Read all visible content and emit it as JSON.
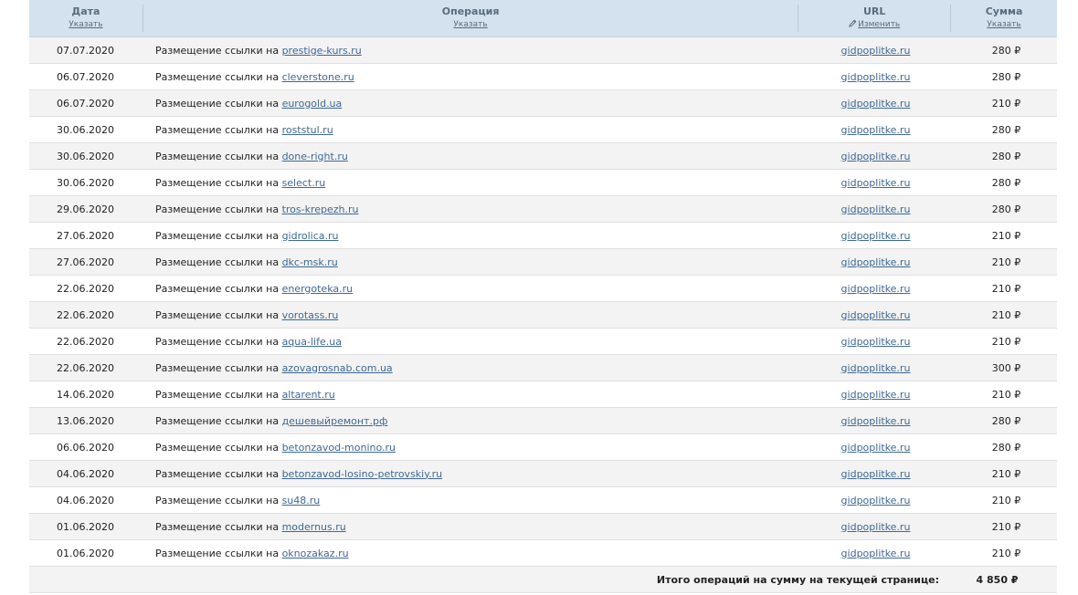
{
  "columns": {
    "date": {
      "title": "Дата",
      "action": "Указать"
    },
    "operation": {
      "title": "Операция",
      "action": "Указать"
    },
    "url": {
      "title": "URL",
      "action": "Изменить"
    },
    "sum": {
      "title": "Сумма",
      "action": "Указать"
    }
  },
  "operation_prefix": "Размещение ссылки на",
  "rows": [
    {
      "date": "07.07.2020",
      "site": "prestige-kurs.ru",
      "url": "gidpoplitke.ru",
      "sum": "280 ₽"
    },
    {
      "date": "06.07.2020",
      "site": "cleverstone.ru",
      "url": "gidpoplitke.ru",
      "sum": "280 ₽"
    },
    {
      "date": "06.07.2020",
      "site": "eurogold.ua",
      "url": "gidpoplitke.ru",
      "sum": "210 ₽"
    },
    {
      "date": "30.06.2020",
      "site": "roststul.ru",
      "url": "gidpoplitke.ru",
      "sum": "280 ₽"
    },
    {
      "date": "30.06.2020",
      "site": "done-right.ru",
      "url": "gidpoplitke.ru",
      "sum": "280 ₽"
    },
    {
      "date": "30.06.2020",
      "site": "select.ru",
      "url": "gidpoplitke.ru",
      "sum": "280 ₽"
    },
    {
      "date": "29.06.2020",
      "site": "tros-krepezh.ru",
      "url": "gidpoplitke.ru",
      "sum": "280 ₽"
    },
    {
      "date": "27.06.2020",
      "site": "gidrolica.ru",
      "url": "gidpoplitke.ru",
      "sum": "210 ₽"
    },
    {
      "date": "27.06.2020",
      "site": "dkc-msk.ru",
      "url": "gidpoplitke.ru",
      "sum": "210 ₽"
    },
    {
      "date": "22.06.2020",
      "site": "energoteka.ru",
      "url": "gidpoplitke.ru",
      "sum": "210 ₽"
    },
    {
      "date": "22.06.2020",
      "site": "vorotass.ru",
      "url": "gidpoplitke.ru",
      "sum": "210 ₽"
    },
    {
      "date": "22.06.2020",
      "site": "aqua-life.ua",
      "url": "gidpoplitke.ru",
      "sum": "210 ₽"
    },
    {
      "date": "22.06.2020",
      "site": "azovagrosnab.com.ua",
      "url": "gidpoplitke.ru",
      "sum": "300 ₽"
    },
    {
      "date": "14.06.2020",
      "site": "altarent.ru",
      "url": "gidpoplitke.ru",
      "sum": "210 ₽"
    },
    {
      "date": "13.06.2020",
      "site": "дешевыйремонт.рф",
      "url": "gidpoplitke.ru",
      "sum": "280 ₽"
    },
    {
      "date": "06.06.2020",
      "site": "betonzavod-monino.ru",
      "url": "gidpoplitke.ru",
      "sum": "280 ₽"
    },
    {
      "date": "04.06.2020",
      "site": "betonzavod-losino-petrovskiy.ru",
      "url": "gidpoplitke.ru",
      "sum": "210 ₽"
    },
    {
      "date": "04.06.2020",
      "site": "su48.ru",
      "url": "gidpoplitke.ru",
      "sum": "210 ₽"
    },
    {
      "date": "01.06.2020",
      "site": "modernus.ru",
      "url": "gidpoplitke.ru",
      "sum": "210 ₽"
    },
    {
      "date": "01.06.2020",
      "site": "oknozakaz.ru",
      "url": "gidpoplitke.ru",
      "sum": "210 ₽"
    }
  ],
  "total": {
    "label": "Итого операций на сумму на текущей странице:",
    "value": "4 850 ₽"
  },
  "colors": {
    "header_bg": "#d3e2ee",
    "header_text": "#5a6c7d",
    "link": "#3f6893",
    "alt_row": "#f3f3f3"
  },
  "icons": {
    "url_action_icon": "pencil-icon"
  }
}
